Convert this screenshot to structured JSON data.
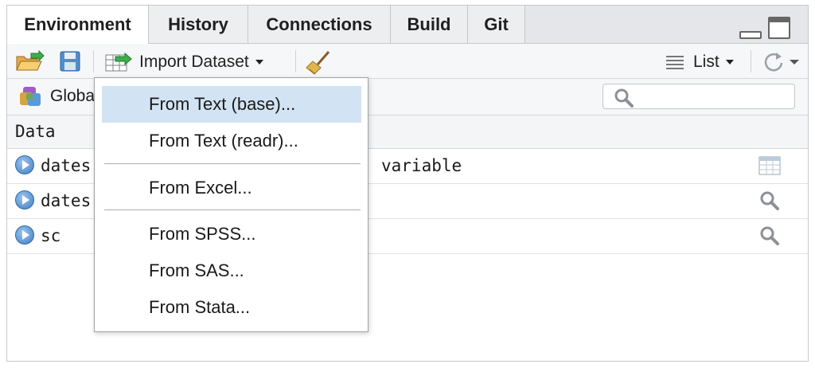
{
  "tabs": [
    {
      "label": "Environment",
      "active": true
    },
    {
      "label": "History",
      "active": false
    },
    {
      "label": "Connections",
      "active": false
    },
    {
      "label": "Build",
      "active": false
    },
    {
      "label": "Git",
      "active": false
    }
  ],
  "toolbar": {
    "import_label": "Import Dataset",
    "view_label": "List"
  },
  "env": {
    "scope_label": "Global Environment",
    "search_placeholder": ""
  },
  "data_section": {
    "header": "Data",
    "rows": [
      {
        "name": "dates",
        "value": "variable",
        "action_icon": "grid-view-icon"
      },
      {
        "name": "dates",
        "value": "",
        "action_icon": "magnifier-icon"
      },
      {
        "name": "sc",
        "value": "",
        "action_icon": "magnifier-icon"
      }
    ]
  },
  "import_menu": {
    "items": [
      {
        "label": "From Text (base)...",
        "selected": true
      },
      {
        "label": "From Text (readr)...",
        "selected": false
      },
      {
        "label": "From Excel...",
        "selected": false
      },
      {
        "label": "From SPSS...",
        "selected": false
      },
      {
        "label": "From SAS...",
        "selected": false
      },
      {
        "label": "From Stata...",
        "selected": false
      }
    ]
  },
  "colors": {
    "menu_highlight": "#d2e3f3",
    "accent_blue": "#3d7fc4",
    "tab_bar": "#e4e6e9"
  }
}
